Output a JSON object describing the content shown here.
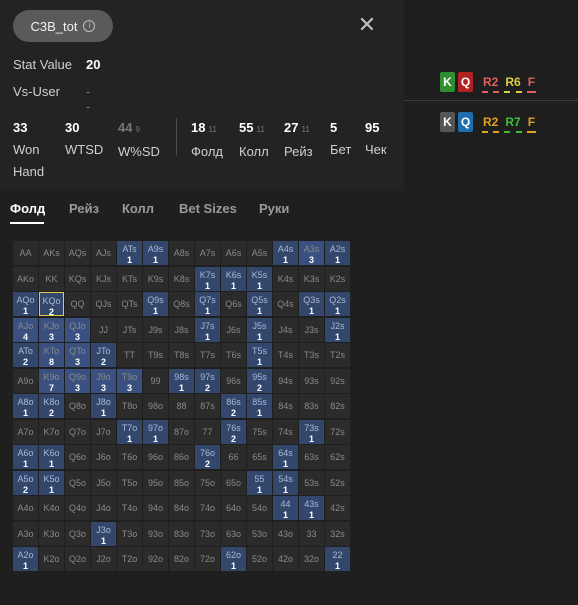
{
  "header": {
    "stat_name": "C3B_tot",
    "info_icon": "info-icon",
    "close_icon": "close-icon"
  },
  "stat_value": {
    "label": "Stat Value",
    "value": "20"
  },
  "vs_user": {
    "label": "Vs-User",
    "value": "--"
  },
  "stats": [
    {
      "num": "33",
      "sub": "",
      "label": "Won\nHand"
    },
    {
      "num": "30",
      "sub": "",
      "label": "WTSD"
    },
    {
      "num": "44",
      "sub": "9",
      "label": "W%SD"
    },
    {
      "num": "18",
      "sub": "11",
      "label": "Фолд"
    },
    {
      "num": "55",
      "sub": "11",
      "label": "Колл"
    },
    {
      "num": "27",
      "sub": "11",
      "label": "Рейз"
    },
    {
      "num": "5",
      "sub": "",
      "label": "Бет"
    },
    {
      "num": "95",
      "sub": "",
      "label": "Чек"
    }
  ],
  "tabs": [
    "Фолд",
    "Рейз",
    "Колл",
    "Bet Sizes",
    "Руки"
  ],
  "active_tab": "Фолд",
  "hands": [
    [
      "AA",
      "AKs",
      "AQs",
      "AJs",
      "ATs",
      "A9s",
      "A8s",
      "A7s",
      "A6s",
      "A5s",
      "A4s",
      "A3s",
      "A2s"
    ],
    [
      "AKo",
      "KK",
      "KQs",
      "KJs",
      "KTs",
      "K9s",
      "K8s",
      "K7s",
      "K6s",
      "K5s",
      "K4s",
      "K3s",
      "K2s"
    ],
    [
      "AQo",
      "KQo",
      "QQ",
      "QJs",
      "QTs",
      "Q9s",
      "Q8s",
      "Q7s",
      "Q6s",
      "Q5s",
      "Q4s",
      "Q3s",
      "Q2s"
    ],
    [
      "AJo",
      "KJo",
      "QJo",
      "JJ",
      "JTs",
      "J9s",
      "J8s",
      "J7s",
      "J6s",
      "J5s",
      "J4s",
      "J3s",
      "J2s"
    ],
    [
      "ATo",
      "KTo",
      "QTo",
      "JTo",
      "TT",
      "T9s",
      "T8s",
      "T7s",
      "T6s",
      "T5s",
      "T4s",
      "T3s",
      "T2s"
    ],
    [
      "A9o",
      "K9o",
      "Q9o",
      "J9o",
      "T9o",
      "99",
      "98s",
      "97s",
      "96s",
      "95s",
      "94s",
      "93s",
      "92s"
    ],
    [
      "A8o",
      "K8o",
      "Q8o",
      "J8o",
      "T8o",
      "98o",
      "88",
      "87s",
      "86s",
      "85s",
      "84s",
      "83s",
      "82s"
    ],
    [
      "A7o",
      "K7o",
      "Q7o",
      "J7o",
      "T7o",
      "97o",
      "87o",
      "77",
      "76s",
      "75s",
      "74s",
      "73s",
      "72s"
    ],
    [
      "A6o",
      "K6o",
      "Q6o",
      "J6o",
      "T6o",
      "96o",
      "86o",
      "76o",
      "66",
      "65s",
      "64s",
      "63s",
      "62s"
    ],
    [
      "A5o",
      "K5o",
      "Q5o",
      "J5o",
      "T5o",
      "95o",
      "85o",
      "75o",
      "65o",
      "55",
      "54s",
      "53s",
      "52s"
    ],
    [
      "A4o",
      "K4o",
      "Q4o",
      "J4o",
      "T4o",
      "94o",
      "84o",
      "74o",
      "64o",
      "54o",
      "44",
      "43s",
      "42s"
    ],
    [
      "A3o",
      "K3o",
      "Q3o",
      "J3o",
      "T3o",
      "93o",
      "83o",
      "73o",
      "63o",
      "53o",
      "43o",
      "33",
      "32s"
    ],
    [
      "A2o",
      "K2o",
      "Q2o",
      "J2o",
      "T2o",
      "92o",
      "82o",
      "72o",
      "62o",
      "52o",
      "42o",
      "32o",
      "22"
    ]
  ],
  "counts": [
    [
      "",
      "",
      "",
      "",
      "1",
      "1",
      "",
      "",
      "",
      "",
      "1",
      "3",
      "1"
    ],
    [
      "",
      "",
      "",
      "",
      "",
      "",
      "",
      "1",
      "1",
      "1",
      "",
      "",
      ""
    ],
    [
      "1",
      "2",
      "",
      "",
      "",
      "1",
      "",
      "1",
      "",
      "1",
      "",
      "1",
      "1"
    ],
    [
      "4",
      "3",
      "3",
      "",
      "",
      "",
      "",
      "1",
      "",
      "1",
      "",
      "",
      "1"
    ],
    [
      "2",
      "8",
      "3",
      "2",
      "",
      "",
      "",
      "",
      "",
      "1",
      "",
      "",
      ""
    ],
    [
      "",
      "7",
      "3",
      "3",
      "3",
      "",
      "1",
      "2",
      "",
      "2",
      "",
      "",
      ""
    ],
    [
      "1",
      "2",
      "",
      "1",
      "",
      "",
      "",
      "",
      "2",
      "1",
      "",
      "",
      ""
    ],
    [
      "",
      "",
      "",
      "",
      "1",
      "1",
      "",
      "",
      "2",
      "",
      "",
      "1",
      ""
    ],
    [
      "1",
      "1",
      "",
      "",
      "",
      "",
      "",
      "2",
      "",
      "",
      "1",
      "",
      ""
    ],
    [
      "2",
      "1",
      "",
      "",
      "",
      "",
      "",
      "",
      "",
      "1",
      "1",
      "",
      ""
    ],
    [
      "",
      "",
      "",
      "",
      "",
      "",
      "",
      "",
      "",
      "",
      "1",
      "1",
      ""
    ],
    [
      "",
      "",
      "",
      "1",
      "",
      "",
      "",
      "",
      "",
      "",
      "",
      "",
      ""
    ],
    [
      "1",
      "",
      "",
      "",
      "",
      "",
      "",
      "",
      "1",
      "",
      "",
      "",
      "1"
    ]
  ],
  "selected_hand": "KQo",
  "right_panel": {
    "row1": {
      "cards": [
        {
          "rank": "K",
          "color": "#2f8f2f"
        },
        {
          "rank": "Q",
          "color": "#b22222"
        }
      ],
      "actions": [
        {
          "text": "R2",
          "color": "#e06060"
        },
        {
          "text": "R6",
          "color": "#d8d040"
        },
        {
          "text": "F",
          "color": "#e06060"
        }
      ]
    },
    "row2": {
      "cards": [
        {
          "rank": "K",
          "color": "#555555"
        },
        {
          "rank": "Q",
          "color": "#1f6fb0"
        }
      ],
      "actions": [
        {
          "text": "R2",
          "color": "#e0a020"
        },
        {
          "text": "R7",
          "color": "#3cc03c"
        },
        {
          "text": "F",
          "color": "#e0a020"
        }
      ]
    }
  }
}
